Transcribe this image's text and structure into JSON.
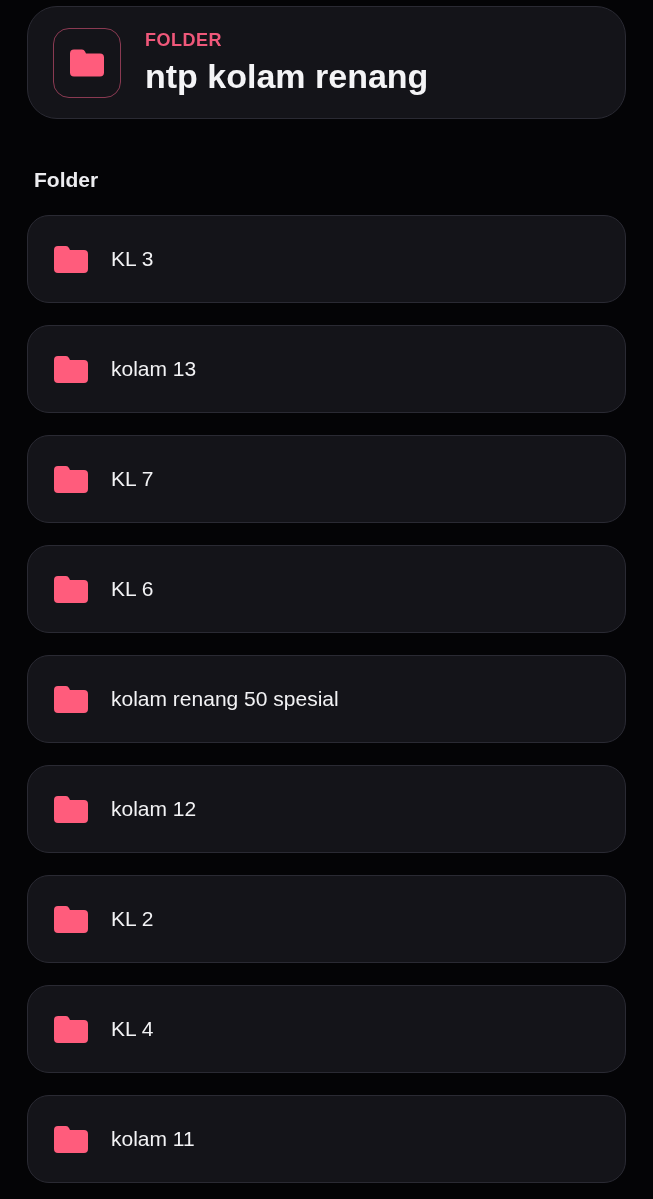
{
  "header": {
    "label": "FOLDER",
    "title": "ntp kolam renang"
  },
  "section": {
    "title": "Folder"
  },
  "folders": [
    {
      "name": "KL 3"
    },
    {
      "name": "kolam 13"
    },
    {
      "name": "KL 7"
    },
    {
      "name": "KL 6"
    },
    {
      "name": "kolam renang 50 spesial"
    },
    {
      "name": "kolam 12"
    },
    {
      "name": "KL 2"
    },
    {
      "name": "KL 4"
    },
    {
      "name": "kolam 11"
    }
  ]
}
